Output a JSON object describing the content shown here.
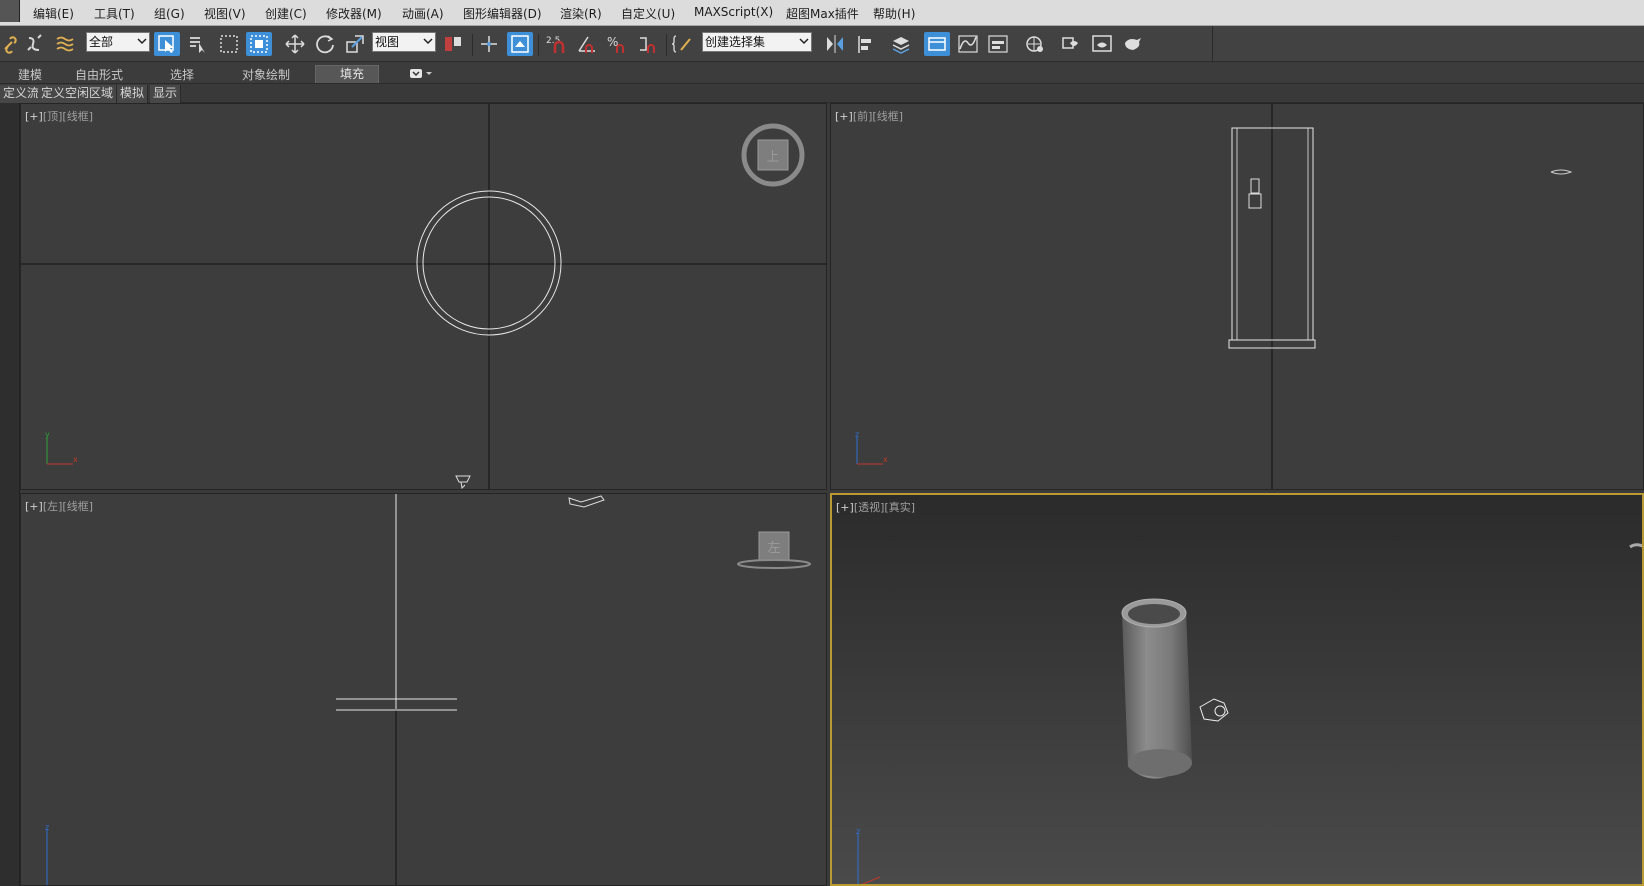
{
  "menu": [
    "编辑(E)",
    "工具(T)",
    "组(G)",
    "视图(V)",
    "创建(C)",
    "修改器(M)",
    "动画(A)",
    "图形编辑器(D)",
    "渲染(R)",
    "自定义(U)",
    "MAXScript(X)",
    "超图Max插件",
    "帮助(H)"
  ],
  "toolbar": {
    "selection_filter": "全部",
    "coordinate_system": "视图",
    "snap_label": "2.5",
    "named_selection_placeholder": "创建选择集"
  },
  "ribbon": {
    "tabs": [
      "建模",
      "自由形式",
      "选择",
      "对象绘制",
      "填充"
    ],
    "selected_tab": "填充"
  },
  "subtoolbar": [
    "定义流",
    "定义空闲区域",
    "模拟",
    "显示"
  ],
  "viewports": {
    "top": {
      "plus": "[+]",
      "view": "[顶]",
      "shading": "[线框]",
      "viewcube_label": "上"
    },
    "front": {
      "plus": "[+]",
      "view": "[前]",
      "shading": "[线框]"
    },
    "left": {
      "plus": "[+]",
      "view": "[左]",
      "shading": "[线框]",
      "viewcube_label": "左"
    },
    "perspective": {
      "plus": "[+]",
      "view": "[透视]",
      "shading": "[真实]"
    }
  },
  "axis": {
    "x": "x",
    "y": "y",
    "z": "z"
  },
  "colors": {
    "viewport_bg": "#3d3d3d",
    "active_border": "#b99a33",
    "selected_tool": "#3d8fd8",
    "axis_x": "#c0392b",
    "axis_y": "#2e9e3a",
    "axis_z": "#2f6fcf"
  }
}
